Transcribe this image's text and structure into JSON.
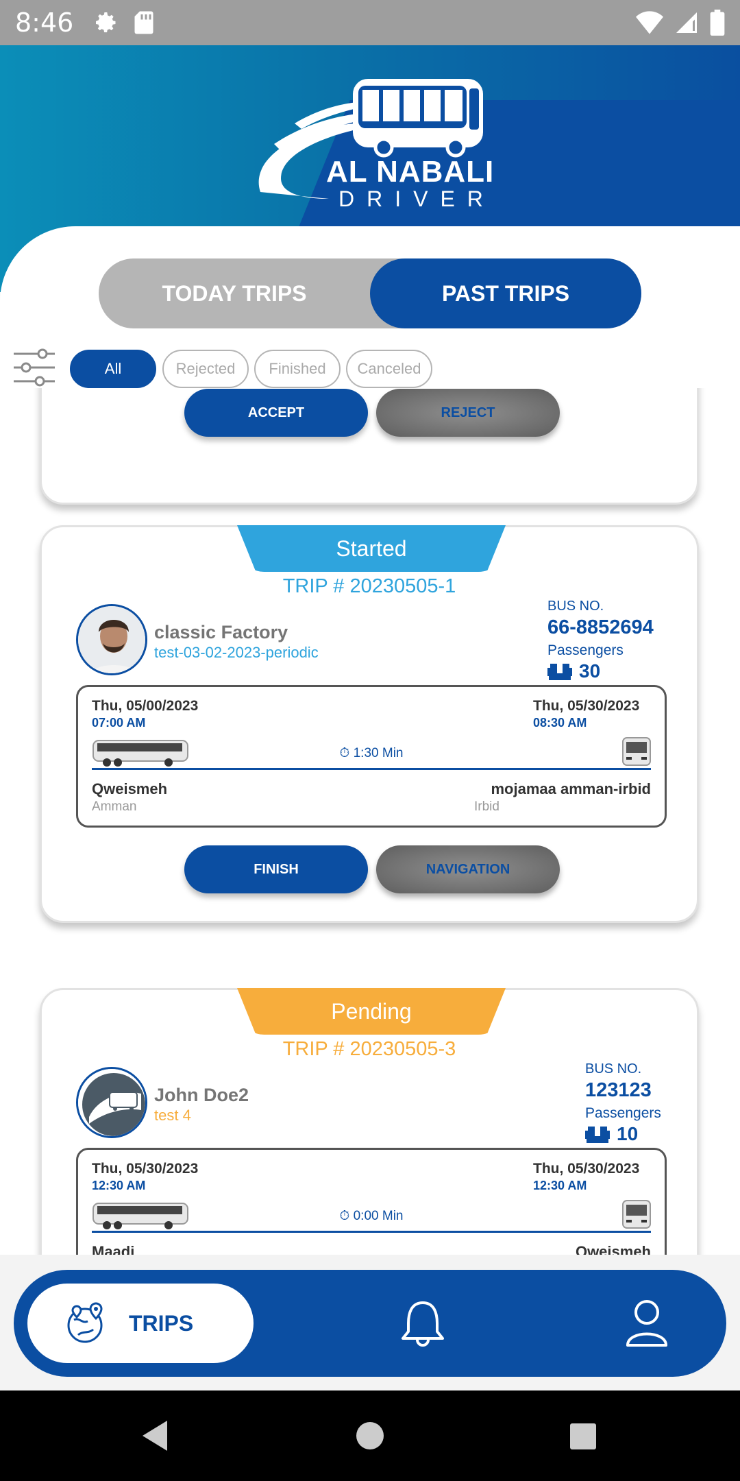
{
  "status_bar": {
    "time": "8:46",
    "icons": [
      "gear-icon",
      "sd-card-icon",
      "wifi-icon",
      "signal-icon",
      "battery-icon"
    ]
  },
  "header": {
    "brand": "AL NABALI",
    "subtitle": "DRIVER"
  },
  "tabs": {
    "today": "TODAY TRIPS",
    "past": "PAST TRIPS",
    "selected": "past"
  },
  "filters": {
    "items": [
      "All",
      "Rejected",
      "Finished",
      "Canceled"
    ],
    "selected": "All"
  },
  "cards": [
    {
      "buttons": {
        "primary": "ACCEPT",
        "secondary": "REJECT"
      }
    },
    {
      "status": "Started",
      "trip_no": "TRIP # 20230505-1",
      "client_name": "classic Factory",
      "client_sub": "test-03-02-2023-periodic",
      "bus_label": "BUS NO.",
      "bus_no": "66-8852694",
      "passengers_label": "Passengers",
      "passengers": "30",
      "from_date": "Thu, 05/00/2023",
      "from_time": "07:00 AM",
      "to_date": "Thu, 05/30/2023",
      "to_time": "08:30 AM",
      "duration": "1:30 Min",
      "from_place": "Qweismeh",
      "from_city": "Amman",
      "to_place": "mojamaa amman-irbid",
      "to_city": "Irbid",
      "buttons": {
        "primary": "FINISH",
        "secondary": "NAVIGATION"
      }
    },
    {
      "status": "Pending",
      "trip_no": "TRIP # 20230505-3",
      "client_name": "John Doe2",
      "client_sub": "test 4",
      "bus_label": "BUS NO.",
      "bus_no": "123123",
      "passengers_label": "Passengers",
      "passengers": "10",
      "from_date": "Thu, 05/30/2023",
      "from_time": "12:30 AM",
      "to_date": "Thu, 05/30/2023",
      "to_time": "12:30 AM",
      "duration": "0:00 Min",
      "from_place": "Maadi",
      "to_place": "Qweismeh"
    }
  ],
  "bottom_nav": {
    "trips": "TRIPS",
    "items": [
      "trips-icon",
      "bell-icon",
      "user-icon"
    ]
  },
  "colors": {
    "primary": "#0b4ea2",
    "started": "#2fa4dd",
    "pending": "#f7ad3c",
    "header_teal": "#0b8eb8"
  }
}
